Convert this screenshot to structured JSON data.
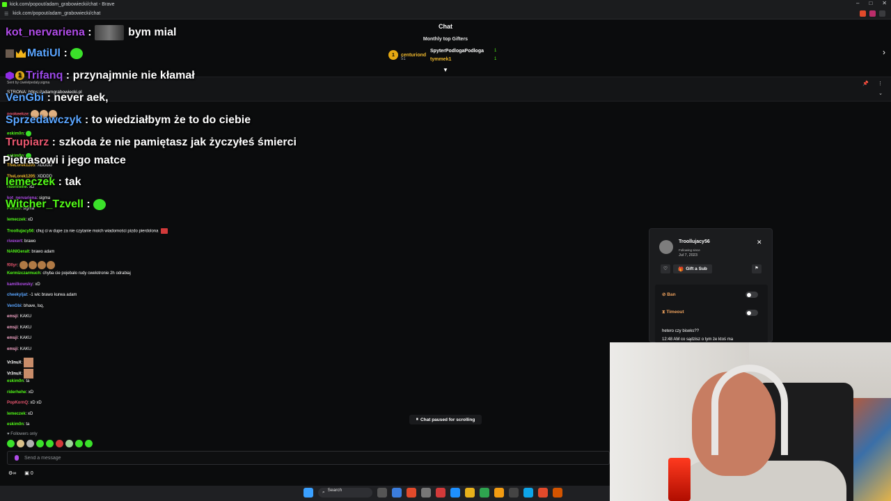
{
  "browser": {
    "title": "kick.com/popout/adam_grabowiecki/chat - Brave",
    "url": "kick.com/popout/adam_grabowiecki/chat"
  },
  "chat_header": {
    "title": "Chat",
    "gifters_title": "Monthly top Gifters",
    "top": {
      "name": "centuriond",
      "count": "51"
    },
    "second": {
      "name": "SpyterPodlogaPodloga",
      "count": "1"
    },
    "third": {
      "name": "tymmek1",
      "count": "1"
    }
  },
  "pinned": {
    "sent_by": "Sent by cwelelpedaly.sigma",
    "text": "STRONA: https://adamgrabowiecki.pl"
  },
  "overlay_messages": [
    {
      "user": "kot_nervariena",
      "color": "#b04ce8",
      "text": "bym mial"
    },
    {
      "user": "MatiUl",
      "color": "#5aa5ff",
      "text": ""
    },
    {
      "user": "Trifanq",
      "color": "#9b49e8",
      "text": "przynajmnie nie kłamał"
    },
    {
      "user": "VenGbi",
      "color": "#5aa5ff",
      "text": "never aek,"
    },
    {
      "user": "Sprzedawczyk",
      "color": "#5aa5ff",
      "text": "to wiedziałbym że to do ciebie"
    },
    {
      "user": "Trupiarz",
      "color": "#e8566e",
      "text": "szkoda że nie pamiętasz jak życzyłeś śmierci"
    },
    {
      "user": "",
      "color": "#fff",
      "text": "Pietrasowi i jego matce"
    },
    {
      "user": "lemeczek",
      "color": "#53fc18",
      "text": "tak"
    },
    {
      "user": "Witcher_Tzvell",
      "color": "#53fc18",
      "text": ""
    }
  ],
  "small_messages": [
    {
      "user": "pookeekze",
      "color": "#e8566e",
      "text": ""
    },
    {
      "user": "eskim0n",
      "color": "#53fc18",
      "text": ""
    },
    {
      "user": "eskim0n",
      "color": "#53fc18",
      "text": ""
    },
    {
      "user": "TheLorek1205",
      "color": "#f0b92d",
      "text": "XDDDD"
    },
    {
      "user": "TheLorek1205",
      "color": "#f0b92d",
      "text": "XDDDD"
    },
    {
      "user": "ridenhehe",
      "color": "#53fc18",
      "text": "xD"
    },
    {
      "user": "kot_nervariena",
      "color": "#b04ce8",
      "text": "sigma"
    },
    {
      "user": "Pellsto",
      "color": "#53fc18",
      "text": "sigma"
    },
    {
      "user": "lemeczek",
      "color": "#53fc18",
      "text": "xD"
    },
    {
      "user": "Troollujacy56",
      "color": "#53fc18",
      "text": "chuj ci w dupe za nie czytanie moich wiadomości pizdo pierdolona"
    },
    {
      "user": "rivexert",
      "color": "#b04ce8",
      "text": "brawo"
    },
    {
      "user": "NANIGeralt",
      "color": "#53fc18",
      "text": "brawo adam"
    },
    {
      "user": "f0llyr",
      "color": "#e8566e",
      "text": ""
    },
    {
      "user": "Kermizczarmuch",
      "color": "#53fc18",
      "text": "chyba cie pojebało rudy cwelotronie 2h odrabiaj"
    },
    {
      "user": "kamilkowsky",
      "color": "#b04ce8",
      "text": "xD"
    },
    {
      "user": "cheekyljat",
      "color": "#5aa5ff",
      "text": "-1 wic brawo kurwa adam"
    },
    {
      "user": "VenGbi",
      "color": "#5aa5ff",
      "text": "bhave, lsq,"
    },
    {
      "user": "emsji",
      "color": "#f6a6c8",
      "text": "KAKU"
    },
    {
      "user": "emsji",
      "color": "#f6a6c8",
      "text": "KAKU"
    },
    {
      "user": "emsji",
      "color": "#f6a6c8",
      "text": "KAKU"
    },
    {
      "user": "emsji",
      "color": "#f6a6c8",
      "text": "KAKU"
    },
    {
      "user": "Vr3nuX",
      "color": "#fff",
      "text": ""
    },
    {
      "user": "Vr3nuX",
      "color": "#fff",
      "text": ""
    },
    {
      "user": "eskim0n",
      "color": "#53fc18",
      "text": "ta"
    },
    {
      "user": "riderhehe",
      "color": "#53fc18",
      "text": "xD"
    },
    {
      "user": "PopKornQ",
      "color": "#e8566e",
      "text": "xD xD"
    },
    {
      "user": "lemeczek",
      "color": "#53fc18",
      "text": "xD"
    },
    {
      "user": "eskim0n",
      "color": "#53fc18",
      "text": "ta"
    }
  ],
  "chat_paused": "Chat paused for scrolling",
  "followers_only": "Followers only",
  "input": {
    "placeholder": "Send a message"
  },
  "bottom": {
    "points": "0"
  },
  "usercard": {
    "name": "Troollujacy56",
    "following_since": "Following since",
    "date": "Jul 7, 2023",
    "gift": "Gift a Sub",
    "ban": "Ban",
    "timeout": "Timeout",
    "log1": "hetero czy biseks??",
    "log2": "12:48 AM co sądzisz o tym że ktoś ma"
  },
  "taskbar": {
    "search": "Search"
  }
}
